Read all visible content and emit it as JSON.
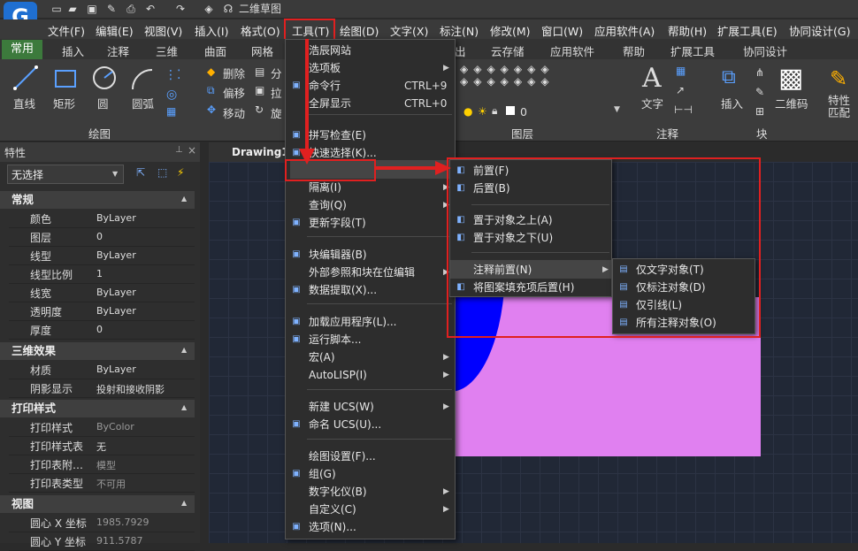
{
  "title": "二维草图",
  "menubar": [
    "文件(F)",
    "编辑(E)",
    "视图(V)",
    "插入(I)",
    "格式(O)",
    "工具(T)",
    "绘图(D)",
    "文字(X)",
    "标注(N)",
    "修改(M)",
    "窗口(W)",
    "应用软件(A)",
    "帮助(H)",
    "扩展工具(E)",
    "协同设计(G)"
  ],
  "ribbon_tabs": [
    "常用",
    "插入",
    "注释",
    "三维",
    "曲面",
    "网格",
    "出",
    "云存储",
    "应用软件",
    "帮助",
    "扩展工具",
    "协同设计"
  ],
  "ribbon": {
    "draw_tools": [
      "直线",
      "矩形",
      "圆",
      "圆弧"
    ],
    "draw_group": "绘图",
    "modify_tools": [
      "删除",
      "分",
      "偏移",
      "拉",
      "移动",
      "旋"
    ],
    "layer_group": "图层",
    "layer_value": "0",
    "annot_tool": "文字",
    "annot_group": "注释",
    "block_tools": [
      "插入",
      "二维码"
    ],
    "block_group": "块",
    "match_tool": "特性匹配"
  },
  "props": {
    "title": "特性",
    "selection": "无选择",
    "sections": [
      {
        "name": "常规",
        "rows": [
          [
            "颜色",
            "ByLayer"
          ],
          [
            "图层",
            "0"
          ],
          [
            "线型",
            "ByLayer"
          ],
          [
            "线型比例",
            "1"
          ],
          [
            "线宽",
            "ByLayer"
          ],
          [
            "透明度",
            "ByLayer"
          ],
          [
            "厚度",
            "0"
          ]
        ]
      },
      {
        "name": "三维效果",
        "rows": [
          [
            "材质",
            "ByLayer"
          ],
          [
            "阴影显示",
            "投射和接收阴影"
          ]
        ]
      },
      {
        "name": "打印样式",
        "rows": [
          [
            "打印样式",
            "ByColor"
          ],
          [
            "打印样式表",
            "无"
          ],
          [
            "打印表附…",
            "模型"
          ],
          [
            "打印表类型",
            "不可用"
          ]
        ]
      },
      {
        "name": "视图",
        "rows": [
          [
            "圆心 X 坐标",
            "1985.7929"
          ],
          [
            "圆心 Y 坐标",
            "911.5787"
          ]
        ]
      }
    ]
  },
  "drawing_tab": "Drawing1.d",
  "tools_menu": [
    {
      "label": "浩辰网站",
      "icon": "",
      "shortcut": "",
      "arrow": false
    },
    {
      "label": "选项板",
      "icon": "",
      "shortcut": "",
      "arrow": true
    },
    {
      "label": "命令行",
      "icon": "cmd-icon",
      "shortcut": "CTRL+9",
      "arrow": false
    },
    {
      "label": "全屏显示",
      "icon": "",
      "shortcut": "CTRL+0",
      "arrow": false
    },
    {
      "label": "拼写检查(E)",
      "icon": "spell-check-icon",
      "shortcut": "",
      "arrow": false
    },
    {
      "label": "快速选择(K)...",
      "icon": "quick-select-icon",
      "shortcut": "",
      "arrow": false
    },
    {
      "label": "绘图次序(D)",
      "icon": "",
      "shortcut": "",
      "arrow": true
    },
    {
      "label": "隔离(I)",
      "icon": "",
      "shortcut": "",
      "arrow": true
    },
    {
      "label": "查询(Q)",
      "icon": "",
      "shortcut": "",
      "arrow": true
    },
    {
      "label": "更新字段(T)",
      "icon": "update-field-icon",
      "shortcut": "",
      "arrow": false
    },
    {
      "label": "块编辑器(B)",
      "icon": "block-editor-icon",
      "shortcut": "",
      "arrow": false
    },
    {
      "label": "外部参照和块在位编辑",
      "icon": "",
      "shortcut": "",
      "arrow": true
    },
    {
      "label": "数据提取(X)...",
      "icon": "data-extract-icon",
      "shortcut": "",
      "arrow": false
    },
    {
      "label": "加载应用程序(L)...",
      "icon": "load-app-icon",
      "shortcut": "",
      "arrow": false
    },
    {
      "label": "运行脚本...",
      "icon": "script-icon",
      "shortcut": "",
      "arrow": false
    },
    {
      "label": "宏(A)",
      "icon": "",
      "shortcut": "",
      "arrow": true
    },
    {
      "label": "AutoLISP(I)",
      "icon": "",
      "shortcut": "",
      "arrow": true
    },
    {
      "label": "新建 UCS(W)",
      "icon": "",
      "shortcut": "",
      "arrow": true
    },
    {
      "label": "命名 UCS(U)...",
      "icon": "ucs-icon",
      "shortcut": "",
      "arrow": false
    },
    {
      "label": "绘图设置(F)...",
      "icon": "",
      "shortcut": "",
      "arrow": false
    },
    {
      "label": "组(G)",
      "icon": "group-icon",
      "shortcut": "",
      "arrow": false
    },
    {
      "label": "数字化仪(B)",
      "icon": "",
      "shortcut": "",
      "arrow": true
    },
    {
      "label": "自定义(C)",
      "icon": "",
      "shortcut": "",
      "arrow": true
    },
    {
      "label": "选项(N)...",
      "icon": "options-icon",
      "shortcut": "",
      "arrow": false
    }
  ],
  "draw_order_menu": [
    {
      "label": "前置(F)",
      "icon": "bring-front-icon",
      "arrow": false
    },
    {
      "label": "后置(B)",
      "icon": "send-back-icon",
      "arrow": false
    },
    {
      "label": "置于对象之上(A)",
      "icon": "above-object-icon",
      "arrow": false
    },
    {
      "label": "置于对象之下(U)",
      "icon": "below-object-icon",
      "arrow": false
    },
    {
      "label": "注释前置(N)",
      "icon": "",
      "arrow": true
    },
    {
      "label": "将图案填充项后置(H)",
      "icon": "hatch-back-icon",
      "arrow": false
    }
  ],
  "annot_front_menu": [
    {
      "label": "仅文字对象(T)",
      "icon": "text-only-icon"
    },
    {
      "label": "仅标注对象(D)",
      "icon": "dim-only-icon"
    },
    {
      "label": "仅引线(L)",
      "icon": "leader-only-icon"
    },
    {
      "label": "所有注释对象(O)",
      "icon": "all-annot-icon"
    }
  ],
  "colors": {
    "accent_red": "#e02020",
    "circle": "#0000ff",
    "rect": "#e080f0"
  }
}
